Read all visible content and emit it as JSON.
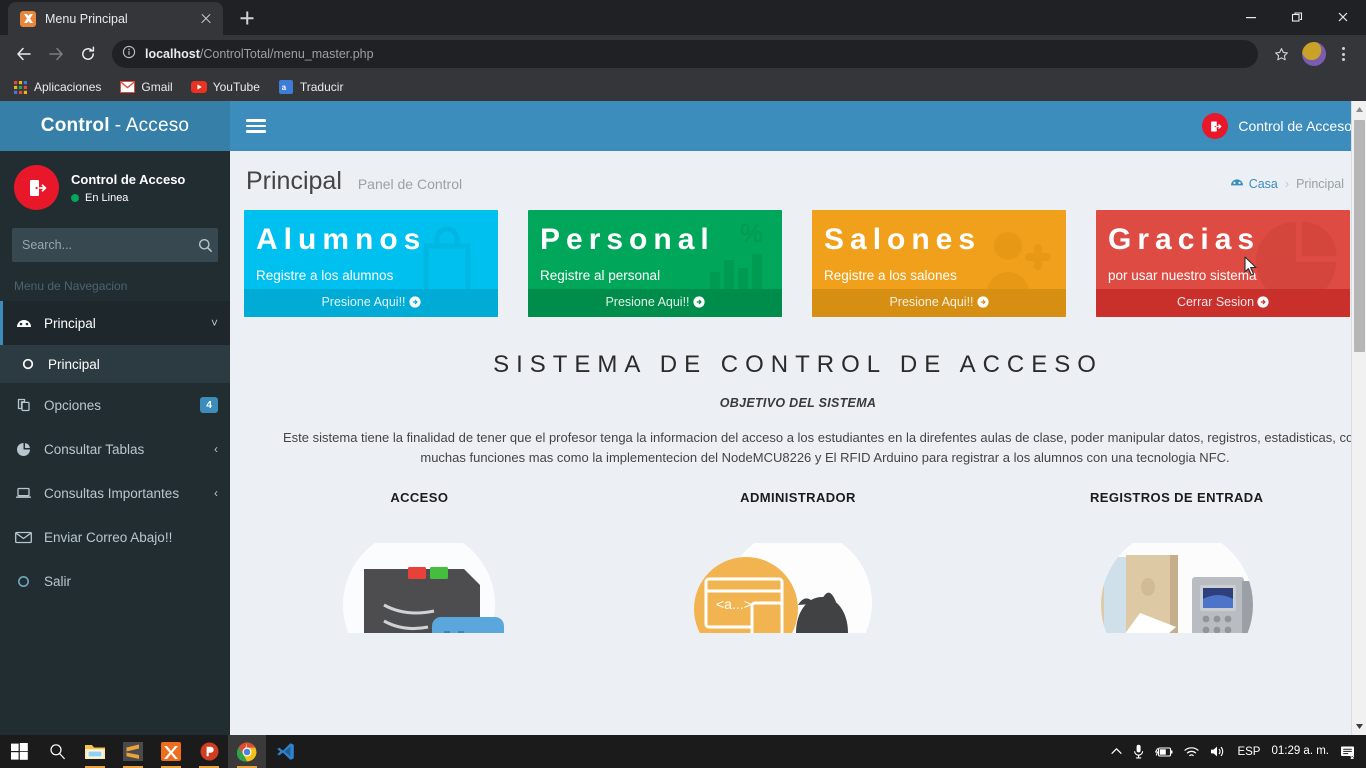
{
  "browser": {
    "tab": {
      "title": "Menu Principal",
      "favicon": "xampp-icon"
    },
    "newtab_label": "+",
    "url_prefix": "localhost",
    "url_suffix": "/ControlTotal/menu_master.php",
    "bookmarks": [
      {
        "label": "Aplicaciones",
        "icon": "apps-grid-icon"
      },
      {
        "label": "Gmail",
        "icon": "gmail-icon"
      },
      {
        "label": "YouTube",
        "icon": "youtube-icon"
      },
      {
        "label": "Traducir",
        "icon": "translate-icon"
      }
    ],
    "window_controls": {
      "minimize": "minimize-icon",
      "maximize": "restore-icon",
      "close": "close-icon"
    }
  },
  "sidebar": {
    "brand_bold": "Control",
    "brand_rest": "- Acceso",
    "user": {
      "name": "Control de Acceso",
      "status": "En Linea"
    },
    "search": {
      "placeholder": "Search...",
      "value": ""
    },
    "nav_header": "Menu de Navegacion",
    "items": [
      {
        "label": "Principal",
        "icon": "dashboard-icon",
        "chevron": "˅",
        "badge": ""
      },
      {
        "label": "Opciones",
        "icon": "copy-icon",
        "chevron": "",
        "badge": "4"
      },
      {
        "label": "Consultar Tablas",
        "icon": "pie-chart-icon",
        "chevron": "‹",
        "badge": ""
      },
      {
        "label": "Consultas Importantes",
        "icon": "laptop-icon",
        "chevron": "‹",
        "badge": ""
      },
      {
        "label": "Enviar Correo Abajo!!",
        "icon": "envelope-icon",
        "chevron": "",
        "badge": ""
      },
      {
        "label": "Salir",
        "icon": "circle-o-icon",
        "chevron": "",
        "badge": ""
      }
    ],
    "subitem": {
      "label": "Principal",
      "icon": "circle-o-icon"
    }
  },
  "navbar": {
    "brand": "Control de Acceso",
    "logo": "door-exit-icon",
    "toggle": "hamburger-icon"
  },
  "page": {
    "title": "Principal",
    "subtitle": "Panel de Control",
    "breadcrumb": {
      "home": "Casa",
      "home_icon": "dashboard-icon",
      "separator": "›",
      "current": "Principal"
    }
  },
  "cards": [
    {
      "title": "Alumnos",
      "desc": "Registre a los alumnos",
      "footer": "Presione Aqui!!",
      "icon": "shopping-bag-icon",
      "color": "#00c0ef",
      "footer_color": "#00acd6"
    },
    {
      "title": "Personal",
      "desc": "Registre al personal",
      "footer": "Presione Aqui!!",
      "icon": "bar-chart-percent-icon",
      "color": "#00a65a",
      "footer_color": "#008d4c"
    },
    {
      "title": "Salones",
      "desc": "Registre a los salones",
      "footer": "Presione Aqui!!",
      "icon": "user-plus-icon",
      "color": "#f0a01a",
      "footer_color": "#d68f12"
    },
    {
      "title": "Gracias",
      "desc": "por usar nuestro sistema",
      "footer": "Cerrar Sesion",
      "icon": "pie-chart-icon",
      "color": "#dd4b42",
      "footer_color": "#c9302c"
    }
  ],
  "system": {
    "heading": "SISTEMA DE CONTROL DE ACCESO",
    "objective_label": "OBJETIVO DEL SISTEMA",
    "paragraph_line1": "Este sistema tiene la finalidad de tener que el profesor tenga la informacion del acceso a los estudiantes en la direfentes aulas de clase, poder manipular datos, registros, estadisticas, cons",
    "paragraph_line2": "muchas funciones mas como la implementecion del NodeMCU8226 y El RFID Arduino para registrar a los alumnos con una tecnologia NFC."
  },
  "columns": [
    {
      "title": "ACCESO",
      "image": "rfid-reader-illustration"
    },
    {
      "title": "ADMINISTRADOR",
      "image": "code-window-illustration"
    },
    {
      "title": "REGISTROS DE ENTRADA",
      "image": "keypad-access-photo"
    }
  ],
  "taskbar": {
    "items": [
      {
        "name": "start-button",
        "icon": "windows-icon"
      },
      {
        "name": "search-button",
        "icon": "search-icon"
      },
      {
        "name": "file-explorer",
        "icon": "folder-icon"
      },
      {
        "name": "sublime-text",
        "icon": "sublime-icon"
      },
      {
        "name": "xampp",
        "icon": "xampp-icon"
      },
      {
        "name": "powerpoint",
        "icon": "powerpoint-icon"
      },
      {
        "name": "chrome",
        "icon": "chrome-icon"
      },
      {
        "name": "vscode",
        "icon": "vscode-icon"
      }
    ],
    "tray": {
      "chevron": "show-hidden-icons",
      "mic": "microphone-icon",
      "battery": "battery-charging-icon",
      "wifi": "wifi-icon",
      "volume": "volume-icon",
      "language": "ESP",
      "time": "01:29 a. m.",
      "notifications": "notification-icon"
    }
  }
}
